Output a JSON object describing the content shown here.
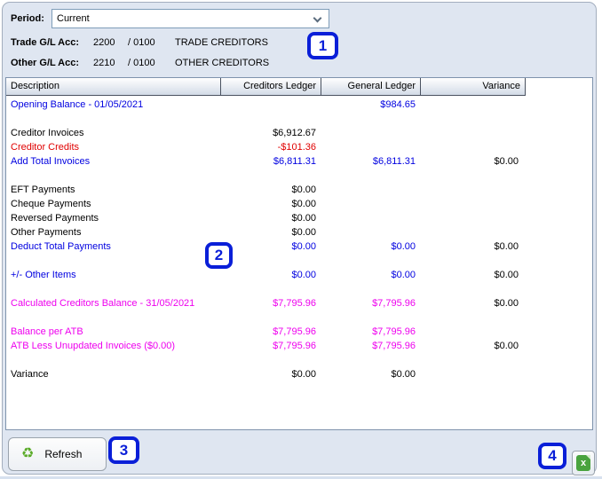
{
  "period": {
    "label": "Period:",
    "value": "Current"
  },
  "accounts": [
    {
      "label": "Trade G/L Acc:",
      "code": "2200",
      "separator": "/ 0100",
      "name": "TRADE CREDITORS"
    },
    {
      "label": "Other G/L Acc:",
      "code": "2210",
      "separator": "/ 0100",
      "name": "OTHER CREDITORS"
    }
  ],
  "table": {
    "columns": [
      "Description",
      "Creditors Ledger",
      "General Ledger",
      "Variance"
    ],
    "rows": [
      {
        "d": "Opening Balance - 01/05/2021",
        "c": "",
        "g": "$984.65",
        "v": "",
        "color": "blue"
      },
      {
        "blank": true
      },
      {
        "d": "Creditor Invoices",
        "c": "$6,912.67",
        "g": "",
        "v": "",
        "color": "black"
      },
      {
        "d": "Creditor Credits",
        "c": "-$101.36",
        "g": "",
        "v": "",
        "color": "red"
      },
      {
        "d": "Add Total Invoices",
        "c": "$6,811.31",
        "g": "$6,811.31",
        "v": "$0.00",
        "color": "blue"
      },
      {
        "blank": true
      },
      {
        "d": "EFT Payments",
        "c": "$0.00",
        "g": "",
        "v": "",
        "color": "black"
      },
      {
        "d": "Cheque Payments",
        "c": "$0.00",
        "g": "",
        "v": "",
        "color": "black"
      },
      {
        "d": "Reversed Payments",
        "c": "$0.00",
        "g": "",
        "v": "",
        "color": "black"
      },
      {
        "d": "Other Payments",
        "c": "$0.00",
        "g": "",
        "v": "",
        "color": "black"
      },
      {
        "d": "Deduct Total Payments",
        "c": "$0.00",
        "g": "$0.00",
        "v": "$0.00",
        "color": "blue"
      },
      {
        "blank": true
      },
      {
        "d": "+/- Other Items",
        "c": "$0.00",
        "g": "$0.00",
        "v": "$0.00",
        "color": "blue"
      },
      {
        "blank": true
      },
      {
        "d": "Calculated Creditors Balance - 31/05/2021",
        "c": "$7,795.96",
        "g": "$7,795.96",
        "v": "$0.00",
        "color": "magenta"
      },
      {
        "blank": true
      },
      {
        "d": "Balance per ATB",
        "c": "$7,795.96",
        "g": "$7,795.96",
        "v": "",
        "color": "magenta"
      },
      {
        "d": "ATB Less Unupdated Invoices ($0.00)",
        "c": "$7,795.96",
        "g": "$7,795.96",
        "v": "$0.00",
        "color": "magenta"
      },
      {
        "blank": true
      },
      {
        "d": "Variance",
        "c": "$0.00",
        "g": "$0.00",
        "v": "",
        "color": "black"
      }
    ]
  },
  "annotations": {
    "n1": "1",
    "n2": "2",
    "n3": "3",
    "n4": "4"
  },
  "footer": {
    "refresh_label": "Refresh",
    "recycle_glyph": "♻",
    "excel_letter": "x"
  },
  "colors": {
    "accent_blue": "#0000e0",
    "negative_red": "#e00000",
    "highlight_magenta": "#ee00ee",
    "annotation_blue": "#0a1fd8",
    "panel_bg": "#dfe6f1",
    "excel_green": "#49a33e",
    "refresh_green": "#5aab28"
  }
}
